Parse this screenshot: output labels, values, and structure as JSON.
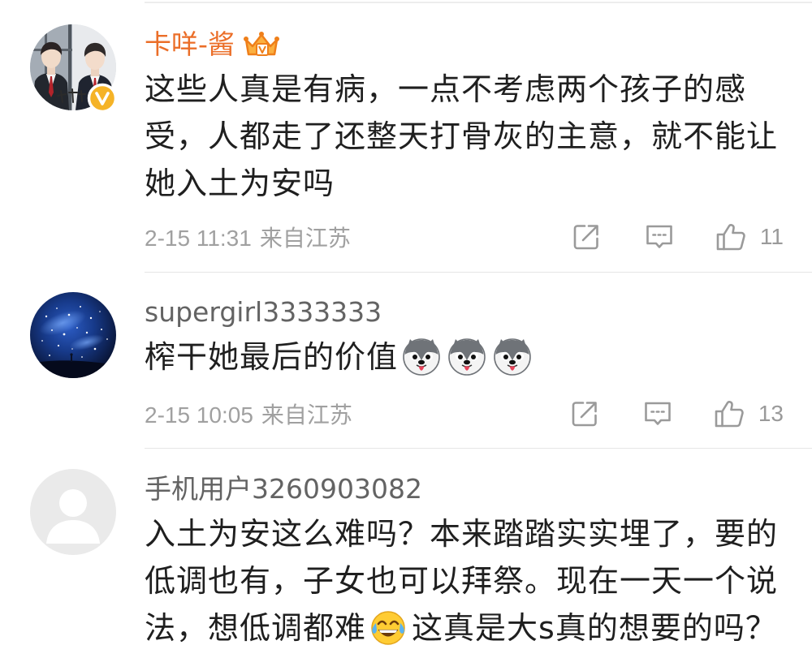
{
  "comments": [
    {
      "avatar": "avatar-photo",
      "avatar_badge": "verified-badge-icon",
      "username": "卡咩-酱",
      "name_color": "#eb6e28",
      "name_badge": "vip-crown-icon",
      "text_lines": [
        "这些人真是有病，一点不考虑两个孩子的感",
        "受，人都走了还整天打骨灰的主意，就不能让",
        "她入土为安吗"
      ],
      "time": "2-15 11:31",
      "source": "来自江苏",
      "likes": "11"
    },
    {
      "avatar": "avatar-starry-sky",
      "username": "supergirl3333333",
      "name_color": "#636363",
      "text_lines": [
        "榨干她最后的价值"
      ],
      "inline_emojis": [
        "husky-emoji",
        "husky-emoji",
        "husky-emoji"
      ],
      "time": "2-15 10:05",
      "source": "来自江苏",
      "likes": "13"
    },
    {
      "avatar": "default-avatar",
      "username": "手机用户3260903082",
      "name_color": "#636363",
      "text_lines": [
        "入土为安这么难吗？本来踏踏实实埋了，要的",
        "低调也有，子女也可以拜祭。现在一天一个说",
        "法，想低调都难"
      ],
      "inline_emoji": "laugh-cry-emoji",
      "text_after_emoji": "这真是大s真的想要的吗？"
    }
  ],
  "action_icons": [
    "share-icon",
    "comment-icon",
    "like-icon"
  ],
  "colors": {
    "background": "#ffffff",
    "vip_name": "#eb6e28",
    "name": "#636363",
    "text": "#1f1f1f",
    "meta": "#a0a0a0",
    "icon": "#9a9a9a",
    "divider": "#e6e6e6",
    "verified": "#f5b327"
  }
}
